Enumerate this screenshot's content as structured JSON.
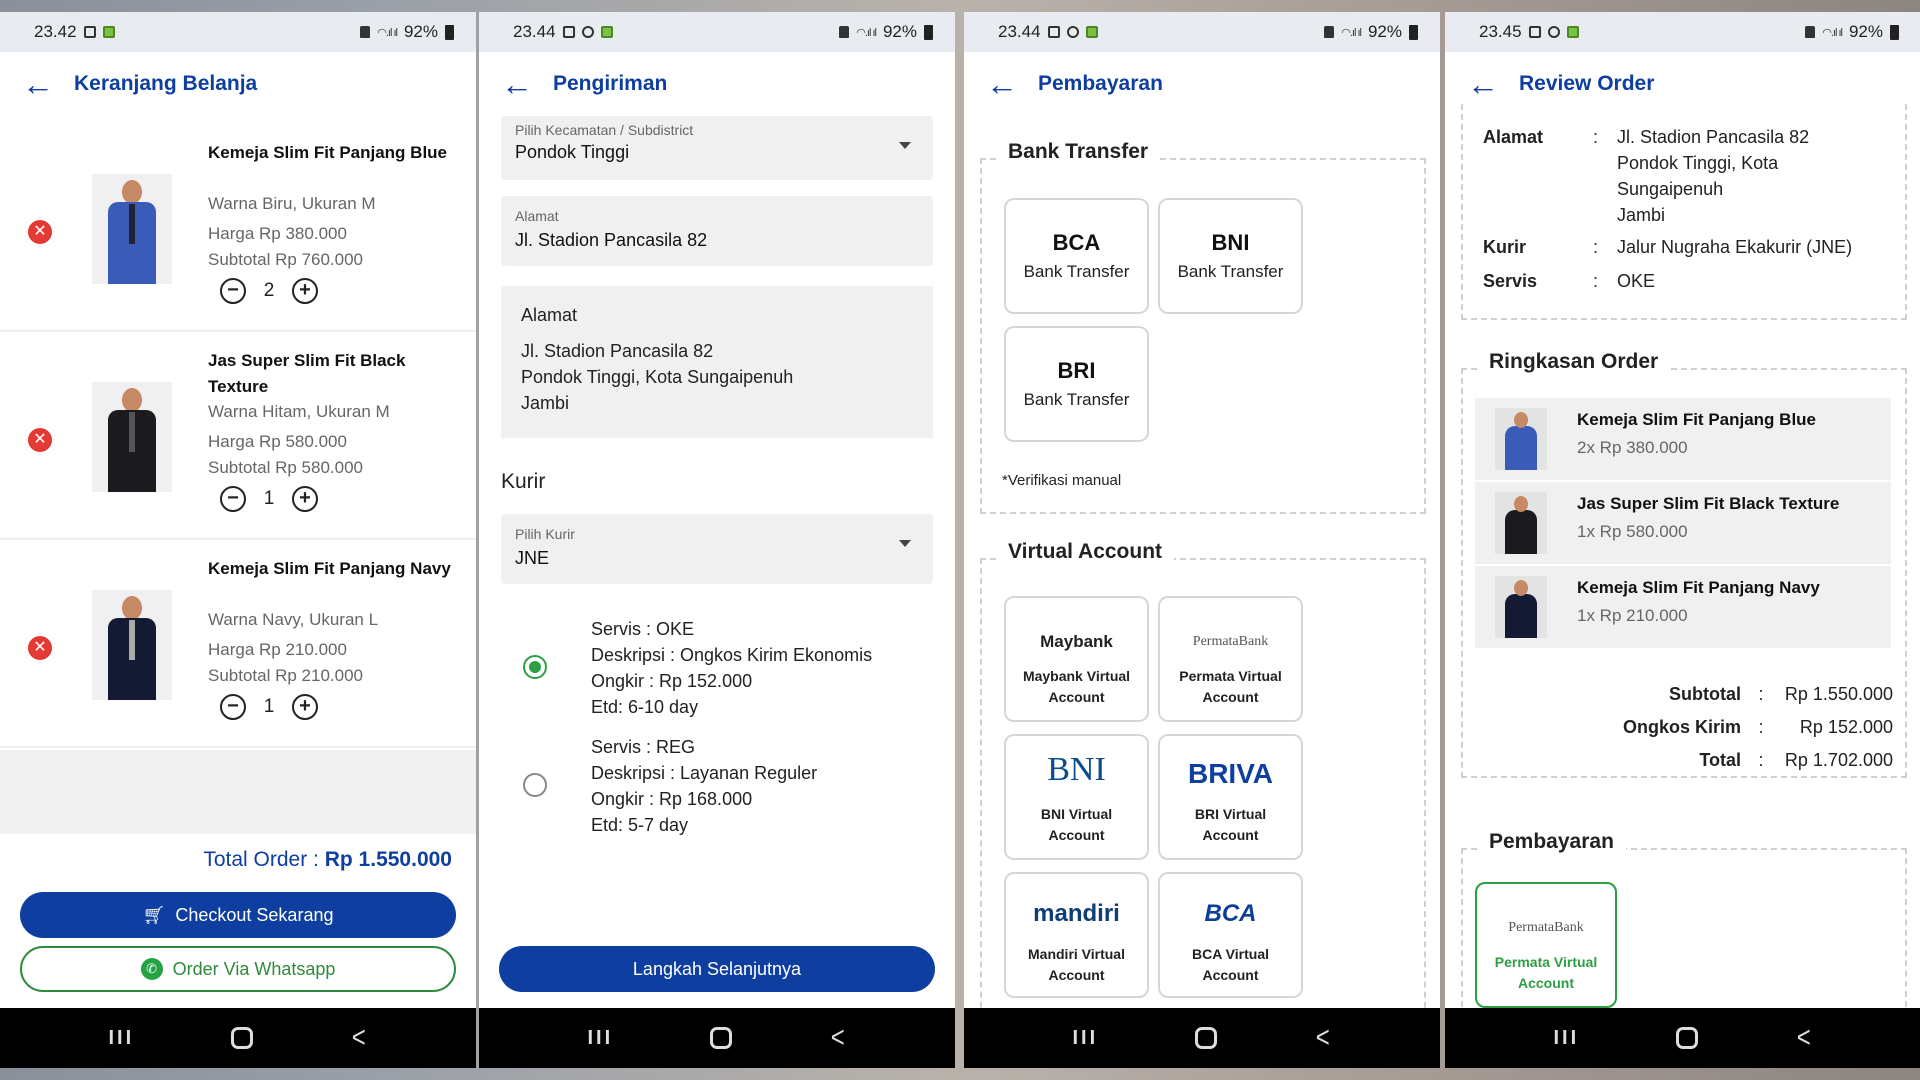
{
  "statusbars": [
    {
      "time": "23.42",
      "battery": "92%"
    },
    {
      "time": "23.44",
      "battery": "92%"
    },
    {
      "time": "23.44",
      "battery": "92%"
    },
    {
      "time": "23.45",
      "battery": "92%"
    }
  ],
  "cart": {
    "title": "Keranjang Belanja",
    "items": [
      {
        "name": "Kemeja Slim Fit Panjang Blue",
        "variant": "Warna Biru, Ukuran M",
        "price": "Harga Rp 380.000",
        "subtotal": "Subtotal Rp 760.000",
        "qty": "2",
        "shirt_color": "#3b5bb8"
      },
      {
        "name": "Jas Super Slim Fit Black Texture",
        "variant": "Warna Hitam, Ukuran M",
        "price": "Harga Rp 580.000",
        "subtotal": "Subtotal Rp 580.000",
        "qty": "1",
        "shirt_color": "#1b1b1f"
      },
      {
        "name": "Kemeja Slim Fit Panjang Navy",
        "variant": "Warna Navy, Ukuran L",
        "price": "Harga Rp 210.000",
        "subtotal": "Subtotal Rp 210.000",
        "qty": "1",
        "shirt_color": "#141a33"
      }
    ],
    "total_label": "Total Order : ",
    "total_value": "Rp 1.550.000",
    "checkout_label": "Checkout Sekarang",
    "whatsapp_label": "Order Via Whatsapp"
  },
  "shipping": {
    "title": "Pengiriman",
    "subdistrict_label": "Pilih Kecamatan / Subdistrict",
    "subdistrict_value": "Pondok Tinggi",
    "address_label": "Alamat",
    "address_value": "Jl. Stadion Pancasila 82",
    "address_box_label": "Alamat",
    "address_lines": [
      "Jl. Stadion Pancasila 82",
      "Pondok Tinggi, Kota Sungaipenuh",
      "Jambi"
    ],
    "courier_heading": "Kurir",
    "courier_label": "Pilih Kurir",
    "courier_value": "JNE",
    "services": [
      {
        "servis": "Servis : OKE",
        "desc": "Deskripsi : Ongkos Kirim Ekonomis",
        "cost": "Ongkir : Rp 152.000",
        "etd": "Etd: 6-10 day",
        "selected": true
      },
      {
        "servis": "Servis : REG",
        "desc": "Deskripsi : Layanan Reguler",
        "cost": "Ongkir : Rp 168.000",
        "etd": "Etd: 5-7 day",
        "selected": false
      }
    ],
    "next_label": "Langkah Selanjutnya"
  },
  "payment": {
    "title": "Pembayaran",
    "bank_transfer_title": "Bank Transfer",
    "banks": [
      {
        "name": "BCA",
        "sub": "Bank Transfer"
      },
      {
        "name": "BNI",
        "sub": "Bank Transfer"
      },
      {
        "name": "BRI",
        "sub": "Bank Transfer"
      }
    ],
    "manual_note": "*Verifikasi manual",
    "va_title": "Virtual Account",
    "va": [
      {
        "logo": "Maybank",
        "label": "Maybank Virtual Account",
        "color": "#222222"
      },
      {
        "logo": "PermataBank",
        "label": "Permata Virtual Account",
        "color": "#555555"
      },
      {
        "logo": "BNI",
        "label": "BNI Virtual Account",
        "color": "#0a4d8c"
      },
      {
        "logo": "BRIVA",
        "label": "BRI Virtual Account",
        "color": "#0d3ea0"
      },
      {
        "logo": "mandiri",
        "label": "Mandiri Virtual Account",
        "color": "#0d3e7a"
      },
      {
        "logo": "BCA",
        "label": "BCA Virtual Account",
        "color": "#0d3e9a"
      }
    ]
  },
  "review": {
    "title": "Review Order",
    "address_key": "Alamat",
    "address_lines": [
      "Jl. Stadion Pancasila 82",
      "Pondok Tinggi, Kota",
      "Sungaipenuh",
      "Jambi"
    ],
    "courier_key": "Kurir",
    "courier_value": "Jalur Nugraha Ekakurir (JNE)",
    "service_key": "Servis",
    "service_value": "OKE",
    "colon": ":",
    "summary_title": "Ringkasan Order",
    "summary_items": [
      {
        "name": "Kemeja Slim Fit Panjang Blue",
        "qty": "2x Rp 380.000",
        "shirt_color": "#3b5bb8"
      },
      {
        "name": "Jas Super Slim Fit Black Texture",
        "qty": "1x Rp 580.000",
        "shirt_color": "#1b1b1f"
      },
      {
        "name": "Kemeja Slim Fit Panjang Navy",
        "qty": "1x Rp 210.000",
        "shirt_color": "#141a33"
      }
    ],
    "subtotal_label": "Subtotal",
    "subtotal_value": "Rp 1.550.000",
    "shipping_label": "Ongkos Kirim",
    "shipping_value": "Rp 152.000",
    "total_label": "Total",
    "total_value": "Rp 1.702.000",
    "payment_title": "Pembayaran",
    "payment_logo": "PermataBank",
    "payment_selected": "Permata Virtual Account"
  },
  "colors": {
    "primary": "#0d3ea0",
    "success": "#2e8b3d",
    "danger": "#e53935"
  }
}
